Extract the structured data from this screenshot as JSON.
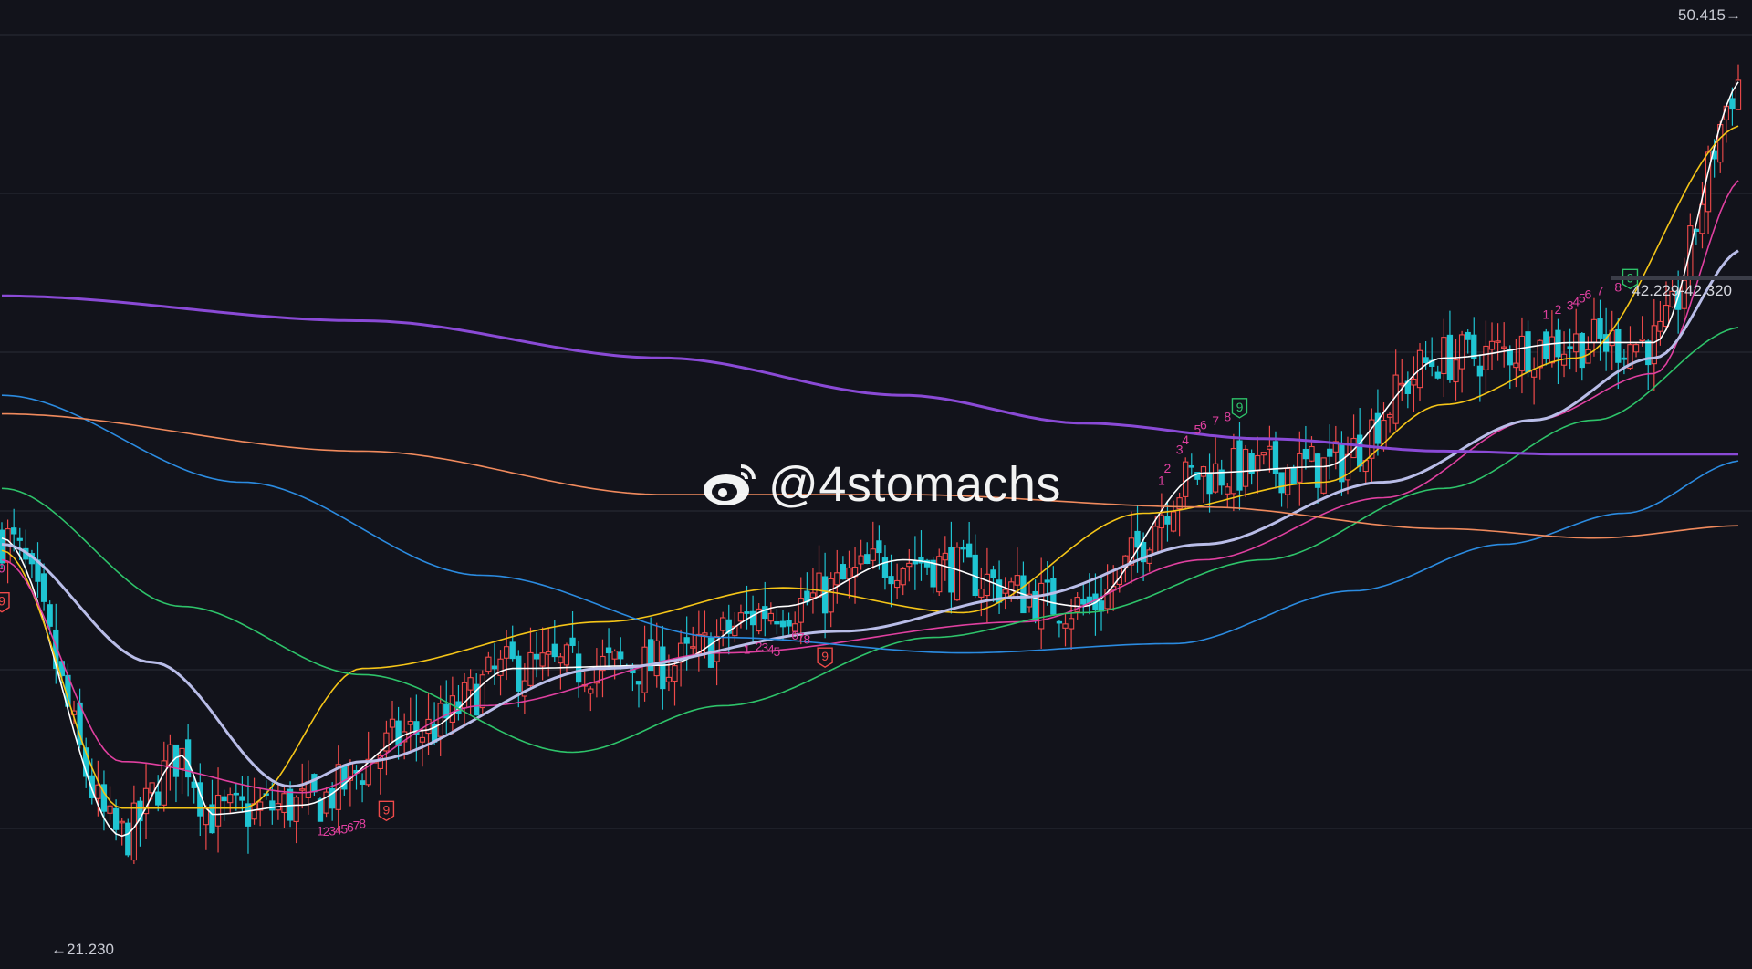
{
  "watermark": {
    "handle": "@4stomachs",
    "icon": "weibo-icon"
  },
  "labels": {
    "high": "50.415→",
    "low": "←21.230",
    "price_range": "42.229-42.320"
  },
  "colors": {
    "background": "#12131b",
    "grid": "#2a2c37",
    "up": "#f04a4a",
    "down": "#1fc4d2",
    "ma5": "#ffffff",
    "ma10": "#f5c518",
    "ma20": "#e040a0",
    "ma30": "#b9bde8",
    "ma60": "#2ec36a",
    "ma120": "#2b8be0",
    "ma250": "#f08a5d",
    "ma500": "#8a4ad6",
    "td_count": "#e040a0"
  },
  "chart_data": {
    "type": "candlestick",
    "title": "",
    "y_range": [
      21.23,
      50.415
    ],
    "price_high": 50.415,
    "price_low": 21.23,
    "current_range": [
      42.229,
      42.32
    ],
    "ohlc_scale": "price",
    "moving_averages": [
      {
        "color": "#ffffff",
        "anchors": [
          [
            0,
            34.2
          ],
          [
            20,
            24.6
          ],
          [
            30,
            27.2
          ],
          [
            35,
            25.3
          ],
          [
            50,
            25.6
          ],
          [
            70,
            28.0
          ],
          [
            85,
            30.0
          ],
          [
            110,
            30.1
          ],
          [
            130,
            32.0
          ],
          [
            150,
            33.5
          ],
          [
            180,
            32.0
          ],
          [
            200,
            36.3
          ],
          [
            220,
            36.5
          ],
          [
            240,
            40.0
          ],
          [
            262,
            40.5
          ],
          [
            275,
            40.5
          ],
          [
            290,
            49.0
          ]
        ]
      },
      {
        "color": "#f5c518",
        "anchors": [
          [
            0,
            33.8
          ],
          [
            20,
            25.5
          ],
          [
            40,
            25.5
          ],
          [
            60,
            30.0
          ],
          [
            100,
            31.5
          ],
          [
            130,
            32.6
          ],
          [
            160,
            31.8
          ],
          [
            190,
            35.0
          ],
          [
            220,
            36.0
          ],
          [
            240,
            38.5
          ],
          [
            262,
            40.0
          ],
          [
            290,
            47.5
          ]
        ]
      },
      {
        "color": "#e040a0",
        "anchors": [
          [
            0,
            33.5
          ],
          [
            20,
            27.0
          ],
          [
            50,
            26.0
          ],
          [
            80,
            28.8
          ],
          [
            120,
            30.5
          ],
          [
            170,
            31.5
          ],
          [
            200,
            33.5
          ],
          [
            230,
            35.5
          ],
          [
            255,
            38.0
          ],
          [
            275,
            39.5
          ],
          [
            290,
            45.8
          ]
        ]
      },
      {
        "color": "#b9bde8",
        "anchors": [
          [
            0,
            34.0
          ],
          [
            25,
            30.2
          ],
          [
            48,
            26.2
          ],
          [
            60,
            27.0
          ],
          [
            100,
            30.0
          ],
          [
            140,
            31.2
          ],
          [
            170,
            32.3
          ],
          [
            200,
            34.0
          ],
          [
            230,
            36.0
          ],
          [
            255,
            38.0
          ],
          [
            275,
            40.0
          ],
          [
            290,
            43.5
          ]
        ]
      },
      {
        "color": "#2ec36a",
        "anchors": [
          [
            0,
            35.8
          ],
          [
            30,
            32.0
          ],
          [
            60,
            29.8
          ],
          [
            95,
            27.3
          ],
          [
            120,
            28.8
          ],
          [
            155,
            31.0
          ],
          [
            180,
            31.8
          ],
          [
            210,
            33.5
          ],
          [
            240,
            35.8
          ],
          [
            265,
            38.0
          ],
          [
            290,
            41.0
          ]
        ]
      },
      {
        "color": "#2b8be0",
        "anchors": [
          [
            0,
            38.8
          ],
          [
            40,
            36.0
          ],
          [
            80,
            33.0
          ],
          [
            120,
            31.0
          ],
          [
            160,
            30.5
          ],
          [
            195,
            30.8
          ],
          [
            225,
            32.5
          ],
          [
            250,
            34.0
          ],
          [
            270,
            35.0
          ],
          [
            290,
            36.7
          ]
        ]
      },
      {
        "color": "#f08a5d",
        "anchors": [
          [
            0,
            38.2
          ],
          [
            60,
            37.0
          ],
          [
            110,
            35.6
          ],
          [
            150,
            35.6
          ],
          [
            200,
            35.2
          ],
          [
            240,
            34.5
          ],
          [
            265,
            34.2
          ],
          [
            290,
            34.6
          ]
        ]
      },
      {
        "color": "#8a4ad6",
        "anchors": [
          [
            0,
            42.0
          ],
          [
            60,
            41.2
          ],
          [
            110,
            40.0
          ],
          [
            150,
            38.8
          ],
          [
            180,
            37.9
          ],
          [
            210,
            37.4
          ],
          [
            240,
            37.0
          ],
          [
            260,
            36.9
          ],
          [
            290,
            36.9
          ]
        ]
      }
    ],
    "td_sequences": [
      {
        "labels": [
          "1",
          "2",
          "3",
          "4",
          "5",
          "6",
          "7",
          "8"
        ],
        "bars": [
          53,
          54,
          55,
          56,
          57,
          58,
          59,
          60
        ],
        "side": "below",
        "final": "9",
        "final_bar": 64
      },
      {
        "labels": [
          "1",
          "2",
          "3",
          "4",
          "5"
        ],
        "bars": [
          124,
          126,
          127,
          128,
          129
        ],
        "side": "below"
      },
      {
        "labels": [
          "6",
          "7",
          "8"
        ],
        "bars": [
          132,
          133,
          134
        ],
        "side": "below",
        "final": "9",
        "final_bar": 137
      },
      {
        "labels": [
          "1",
          "2",
          "3",
          "4",
          "5",
          "6",
          "7",
          "8"
        ],
        "bars": [
          193,
          194,
          196,
          197,
          199,
          200,
          202,
          204
        ],
        "side": "above",
        "final": "9",
        "final_bar": 206
      },
      {
        "labels": [
          "1",
          "2",
          "3",
          "4",
          "5",
          "6",
          "7",
          "8"
        ],
        "bars": [
          257,
          259,
          261,
          262,
          263,
          264,
          266,
          269
        ],
        "side": "above",
        "final": "9",
        "final_bar": 271
      },
      {
        "labels": [
          "9"
        ],
        "bars": [
          0
        ],
        "side": "below",
        "final": "9",
        "final_bar": 0
      }
    ],
    "candle_count": 290
  }
}
